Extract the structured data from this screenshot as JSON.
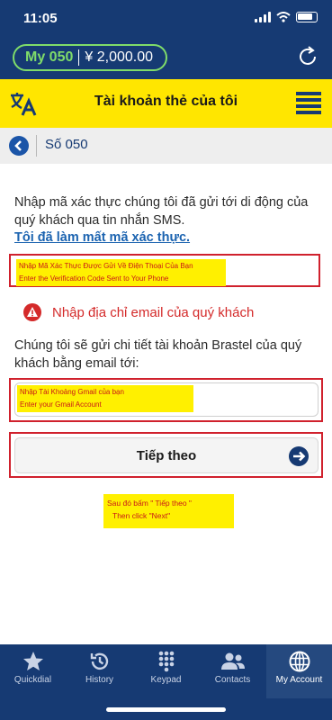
{
  "status_bar": {
    "time": "11:05"
  },
  "account": {
    "number": "My 050",
    "balance": "¥ 2,000.00"
  },
  "header": {
    "title": "Tài khoản thẻ của tôi"
  },
  "breadcrumb": {
    "title": "Số 050"
  },
  "verification": {
    "instruction": "Nhập mã xác thực chúng tôi đã gửi tới di động của quý khách qua tin nhắn SMS.",
    "lost_code_link": "Tôi đã làm mất mã xác thực.",
    "note_line1": "Nhập Mã Xác Thực Được Gửi Về Điện Thoại Của Bạn",
    "note_line2": "Enter the Verification Code Sent to Your Phone"
  },
  "error": {
    "message": "Nhập địa chỉ email của quý khách"
  },
  "email": {
    "description": "Chúng tôi sẽ gửi chi tiết tài khoản Brastel của quý khách bằng email tới:",
    "note_line1": "Nhập Tài Khoảng Gmail của bạn",
    "note_line2": "Enter your Gmail Account"
  },
  "next_button": {
    "label": "Tiếp theo"
  },
  "after_note": {
    "line1": "Sau đó bấm \" Tiếp theo \"",
    "line2": "Then click \"Next\""
  },
  "tabs": [
    {
      "label": "Quickdial",
      "icon": "star-icon"
    },
    {
      "label": "History",
      "icon": "history-icon"
    },
    {
      "label": "Keypad",
      "icon": "keypad-icon"
    },
    {
      "label": "Contacts",
      "icon": "contacts-icon"
    },
    {
      "label": "My Account",
      "icon": "globe-icon",
      "active": true
    }
  ],
  "colors": {
    "navy": "#163a73",
    "yellow": "#ffe600",
    "green": "#7fdc6a",
    "red": "#d42a2a",
    "link": "#1b63b0"
  }
}
